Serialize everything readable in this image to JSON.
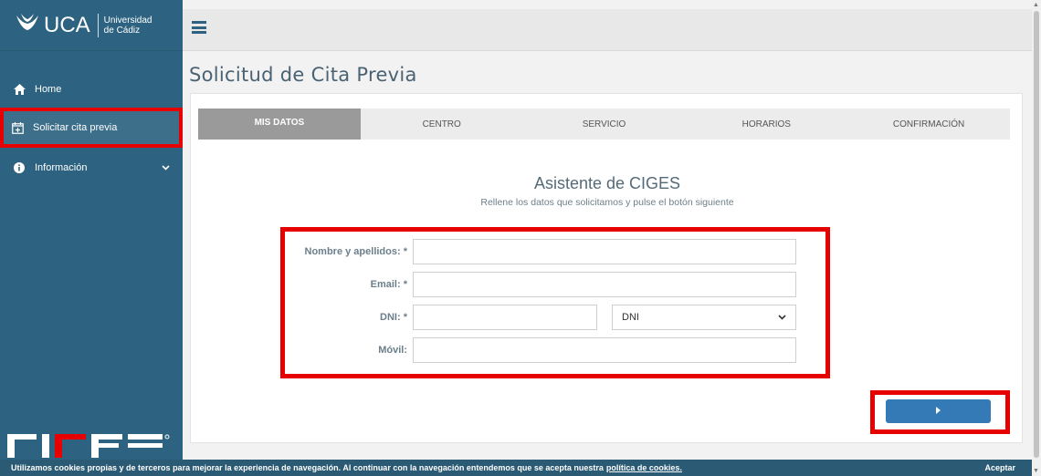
{
  "brand": {
    "name": "UCA",
    "sub_line1": "Universidad",
    "sub_line2": "de Cádiz"
  },
  "sidebar": {
    "items": [
      {
        "label": "Home",
        "icon": "home-icon"
      },
      {
        "label": "Solicitar cita previa",
        "icon": "calendar-plus-icon"
      },
      {
        "label": "Información",
        "icon": "info-circle-icon"
      }
    ],
    "footer_logo": "CIGES"
  },
  "topbar": {
    "menu_icon": "hamburger-icon"
  },
  "page": {
    "title": "Solicitud de Cita Previa"
  },
  "wizard": {
    "steps": [
      "MIS DATOS",
      "CENTRO",
      "SERVICIO",
      "HORARIOS",
      "CONFIRMACIÓN"
    ],
    "active_step": 0,
    "title": "Asistente de CIGES",
    "subtitle": "Rellene los datos que solicitamos y pulse el botón siguiente",
    "fields": {
      "name_label": "Nombre y apellidos: *",
      "email_label": "Email: *",
      "dni_label": "DNI: *",
      "dni_type_selected": "DNI",
      "mobile_label": "Móvil:"
    },
    "next_icon": "caret-right-icon"
  },
  "cookie_bar": {
    "text": "Utilizamos cookies propias y de terceros para mejorar la experiencia de navegación. Al continuar con la navegación entendemos que se acepta nuestra",
    "link": "política de cookies.",
    "accept": "Aceptar"
  },
  "colors": {
    "sidebar": "#2d6380",
    "highlight": "#e60000",
    "primary_button": "#337ab7"
  }
}
